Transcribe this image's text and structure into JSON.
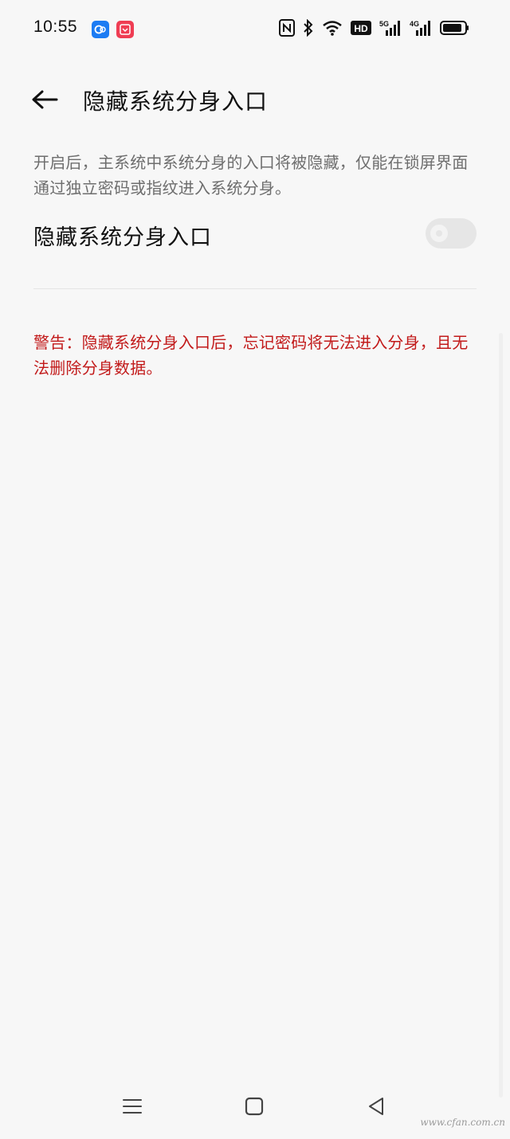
{
  "status_bar": {
    "time": "10:55",
    "hd_label": "HD",
    "signal1_label": "5G",
    "signal2_label": "4G",
    "icons": [
      "nfc-icon",
      "bluetooth-icon",
      "wifi-icon",
      "hd-icon",
      "signal-5g-icon",
      "signal-4g-icon",
      "battery-icon"
    ],
    "notification_badges": [
      "blue-app-icon",
      "red-app-icon"
    ]
  },
  "header": {
    "title": "隐藏系统分身入口",
    "back_icon": "arrow-left-icon"
  },
  "content": {
    "description": "开启后，主系统中系统分身的入口将被隐藏，仅能在锁屏界面通过独立密码或指纹进入系统分身。",
    "setting_label": "隐藏系统分身入口",
    "toggle_state": "off",
    "warning": "警告：隐藏系统分身入口后，忘记密码将无法进入分身，且无法删除分身数据。"
  },
  "nav_bar": {
    "buttons": [
      "menu-icon",
      "home-icon",
      "back-triangle-icon"
    ]
  },
  "watermark": "www.cfan.com.cn",
  "colors": {
    "background": "#f7f7f7",
    "warning": "#c21a1a",
    "muted_text": "#6e6e6e"
  }
}
